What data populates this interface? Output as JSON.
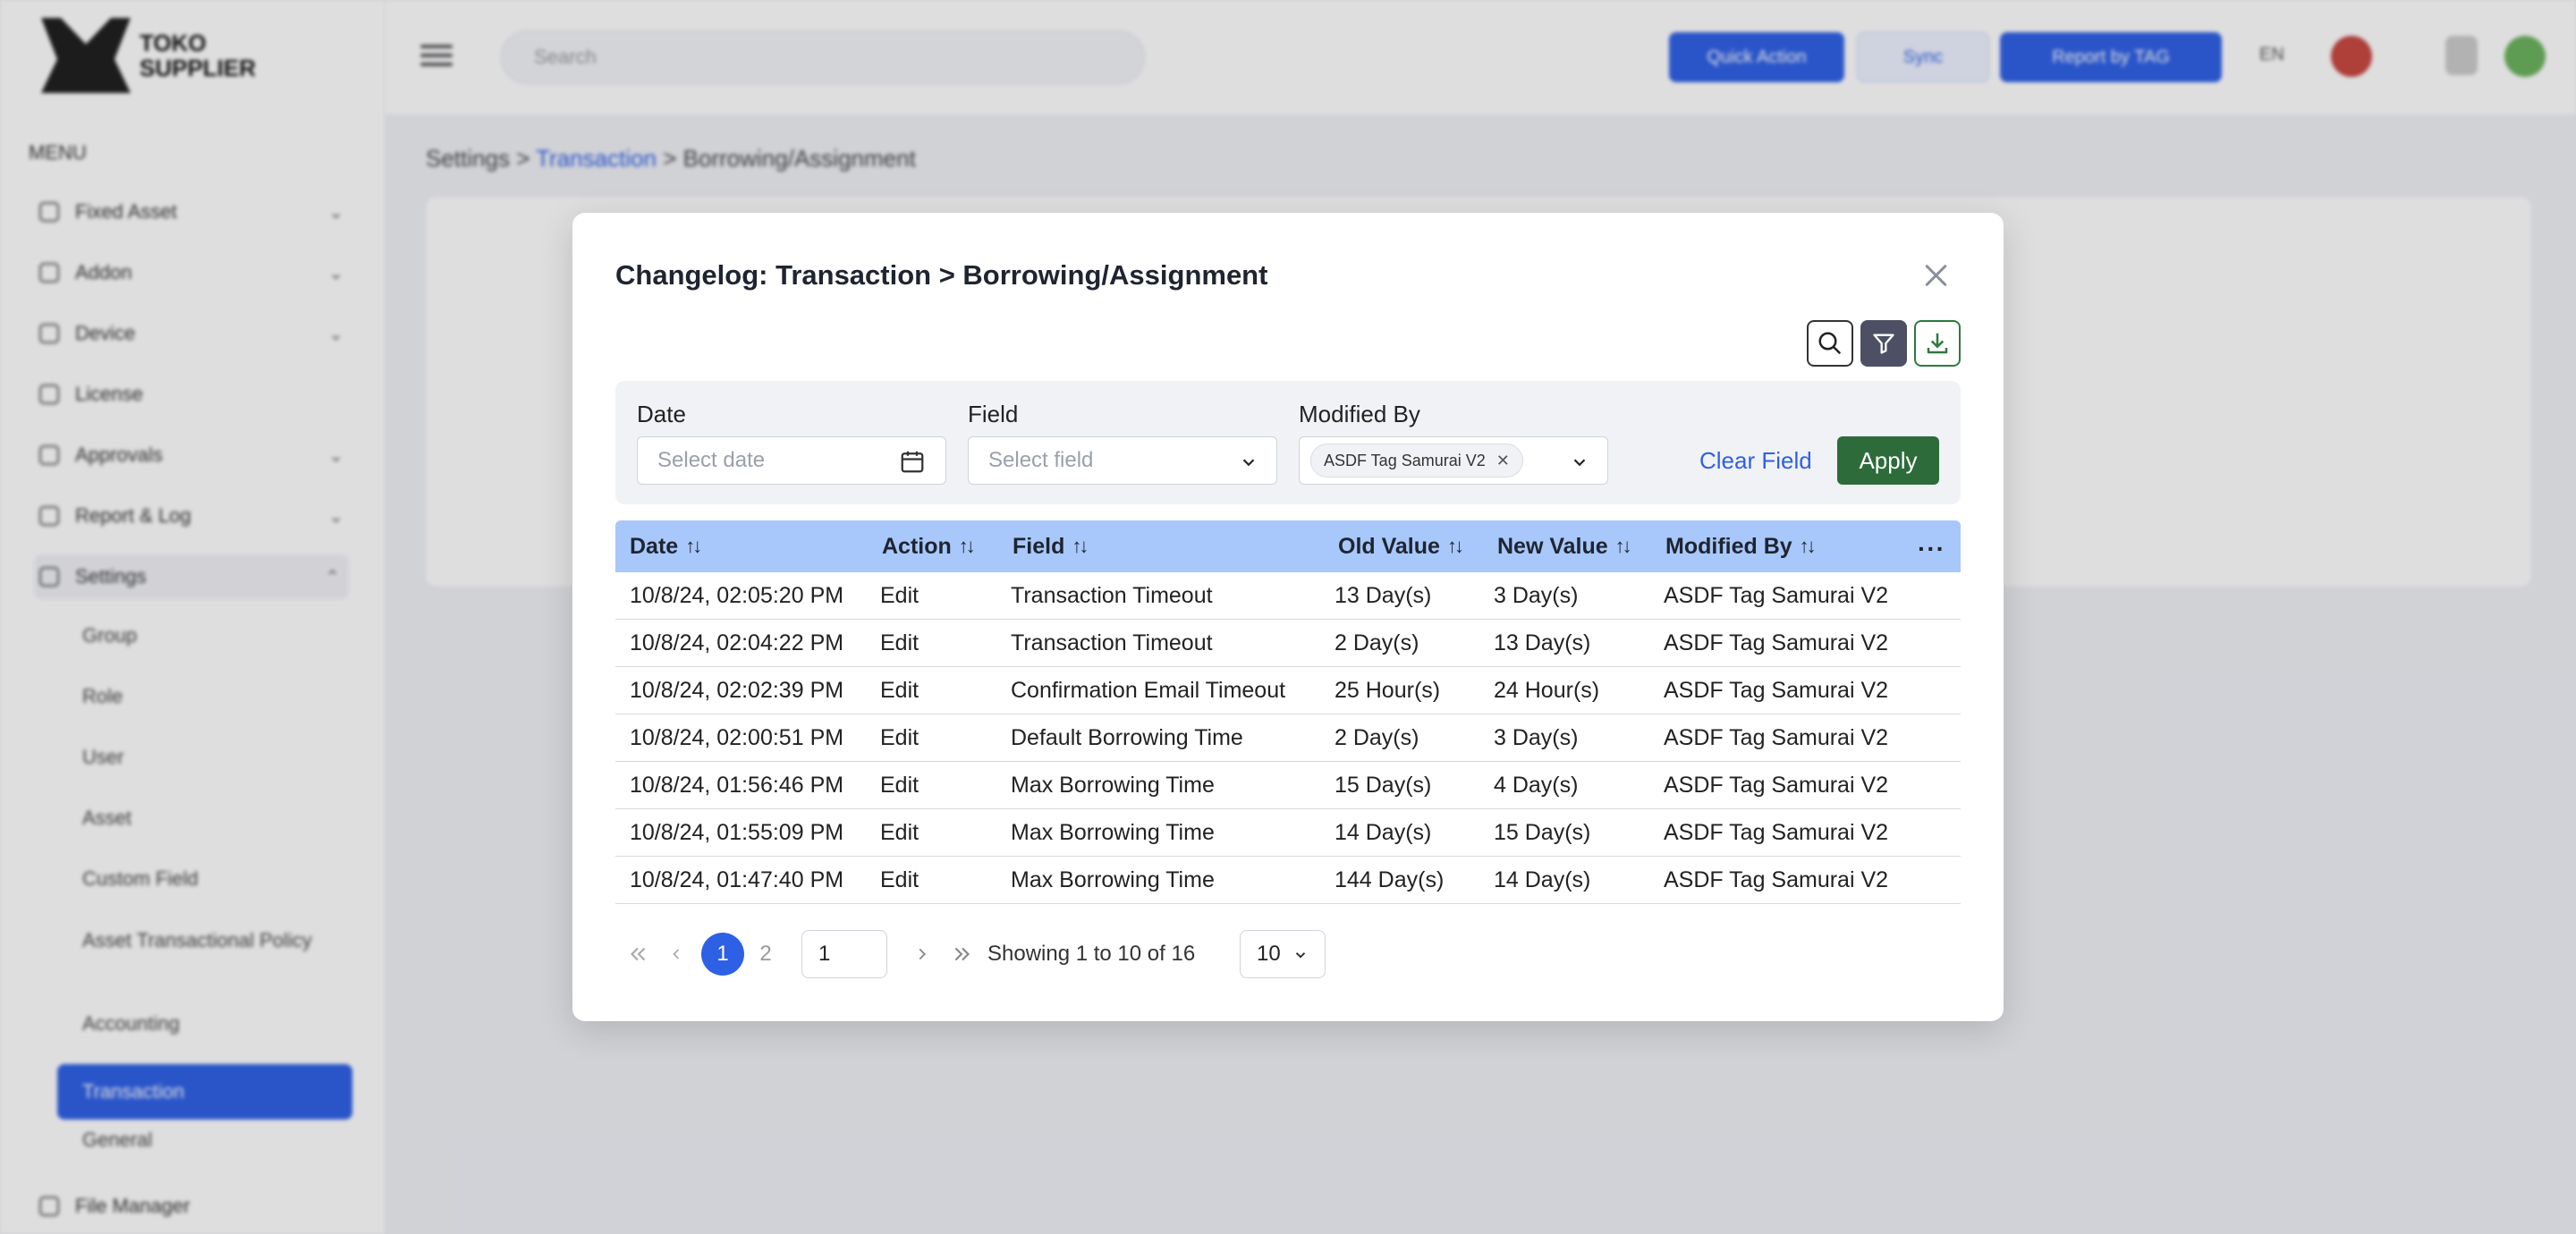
{
  "app": {
    "logo_text": "TOKO\nSUPPLIER",
    "menu_heading": "MENU",
    "search_placeholder": "Search",
    "top_buttons": [
      "Quick Action",
      "Sync",
      "Report by TAG"
    ],
    "lang_code": "EN",
    "sidebar": [
      {
        "label": "Fixed Asset",
        "chevron": "⌄"
      },
      {
        "label": "Addon",
        "chevron": "⌄"
      },
      {
        "label": "Device",
        "chevron": "⌄"
      },
      {
        "label": "License",
        "chevron": ""
      },
      {
        "label": "Approvals",
        "chevron": "⌄"
      },
      {
        "label": "Report & Log",
        "chevron": "⌄"
      },
      {
        "label": "Settings",
        "chevron": "⌃"
      }
    ],
    "settings_sub": [
      "Group",
      "Role",
      "User",
      "Asset",
      "Custom Field",
      "Asset Transactional Policy",
      "Accounting",
      "Transaction",
      "General"
    ],
    "sidebar_last": "File Manager",
    "breadcrumb": {
      "root": "Settings",
      "sep": ">",
      "link": "Transaction",
      "current": "Borrowing/Assignment"
    }
  },
  "modal": {
    "title": "Changelog: Transaction > Borrowing/Assignment",
    "filters": {
      "date_label": "Date",
      "date_placeholder": "Select date",
      "field_label": "Field",
      "field_placeholder": "Select field",
      "modified_by_label": "Modified By",
      "modified_by_chip": "ASDF Tag Samurai V2",
      "clear_label": "Clear Field",
      "apply_label": "Apply"
    },
    "columns": [
      "Date",
      "Action",
      "Field",
      "Old Value",
      "New Value",
      "Modified By"
    ],
    "rows": [
      [
        "10/8/24, 02:05:20 PM",
        "Edit",
        "Transaction Timeout",
        "13 Day(s)",
        "3 Day(s)",
        "ASDF Tag Samurai V2"
      ],
      [
        "10/8/24, 02:04:22 PM",
        "Edit",
        "Transaction Timeout",
        "2 Day(s)",
        "13 Day(s)",
        "ASDF Tag Samurai V2"
      ],
      [
        "10/8/24, 02:02:39 PM",
        "Edit",
        "Confirmation Email Timeout",
        "25 Hour(s)",
        "24 Hour(s)",
        "ASDF Tag Samurai V2"
      ],
      [
        "10/8/24, 02:00:51 PM",
        "Edit",
        "Default Borrowing Time",
        "2 Day(s)",
        "3 Day(s)",
        "ASDF Tag Samurai V2"
      ],
      [
        "10/8/24, 01:56:46 PM",
        "Edit",
        "Max Borrowing Time",
        "15 Day(s)",
        "4 Day(s)",
        "ASDF Tag Samurai V2"
      ],
      [
        "10/8/24, 01:55:09 PM",
        "Edit",
        "Max Borrowing Time",
        "14 Day(s)",
        "15 Day(s)",
        "ASDF Tag Samurai V2"
      ],
      [
        "10/8/24, 01:47:40 PM",
        "Edit",
        "Max Borrowing Time",
        "144 Day(s)",
        "14 Day(s)",
        "ASDF Tag Samurai V2"
      ]
    ],
    "pagination": {
      "pages": [
        "1",
        "2"
      ],
      "current_page": "1",
      "page_input": "1",
      "info": "Showing 1 to 10 of 16",
      "page_size": "10"
    }
  },
  "colors": {
    "primary": "#2e60e6",
    "apply_green": "#2d6b3b",
    "header_blue": "#a8c8fb"
  }
}
